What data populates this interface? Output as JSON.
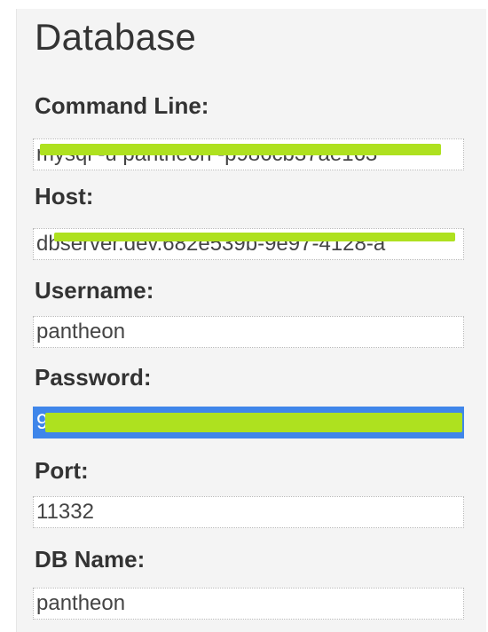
{
  "section": {
    "title": "Database"
  },
  "fields": {
    "command_line": {
      "label": "Command Line:",
      "value": "mysql -u pantheon -p986cb37ae163"
    },
    "host": {
      "label": "Host:",
      "value": "dbserver.dev.682e539b-9e97-4128-a"
    },
    "username": {
      "label": "Username:",
      "value": "pantheon"
    },
    "password": {
      "label": "Password:",
      "value": "9"
    },
    "port": {
      "label": "Port:",
      "value": "11332"
    },
    "db_name": {
      "label": "DB Name:",
      "value": "pantheon"
    }
  },
  "colors": {
    "selection": "#3f86ea",
    "redaction": "#aee11f",
    "panel_background": "#f4f4f4"
  }
}
